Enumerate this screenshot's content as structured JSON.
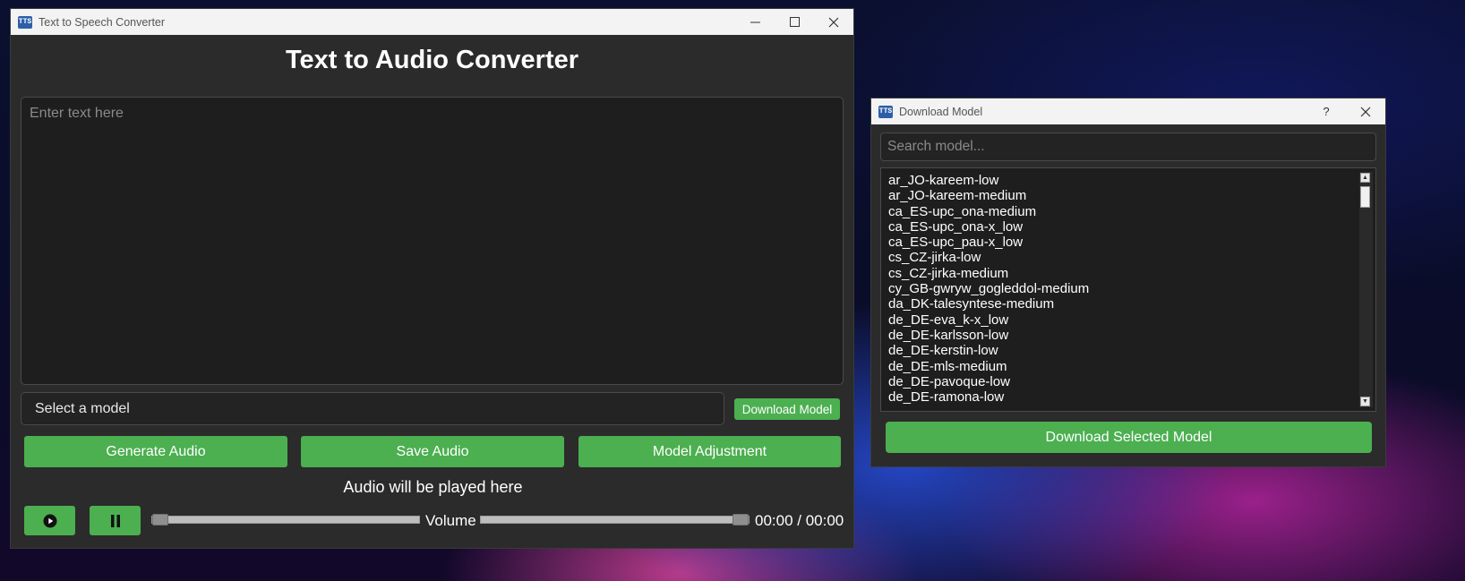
{
  "main_window": {
    "title": "Text to Speech Converter",
    "heading": "Text to Audio Converter",
    "text_placeholder": "Enter text here",
    "model_select": "Select a model",
    "download_model_label": "Download Model",
    "buttons": {
      "generate": "Generate Audio",
      "save": "Save Audio",
      "adjust": "Model Adjustment"
    },
    "status": "Audio will be played here",
    "volume_label": "Volume",
    "time": "00:00 / 00:00",
    "progress_fraction": 0.0,
    "volume_fraction": 1.0,
    "icons": {
      "app": "app-icon",
      "minimize": "minimize-icon",
      "maximize": "maximize-icon",
      "close": "close-icon",
      "play": "play-icon",
      "pause": "pause-icon"
    }
  },
  "dialog": {
    "title": "Download Model",
    "help": "?",
    "search_placeholder": "Search model...",
    "models": [
      "ar_JO-kareem-low",
      "ar_JO-kareem-medium",
      "ca_ES-upc_ona-medium",
      "ca_ES-upc_ona-x_low",
      "ca_ES-upc_pau-x_low",
      "cs_CZ-jirka-low",
      "cs_CZ-jirka-medium",
      "cy_GB-gwryw_gogleddol-medium",
      "da_DK-talesyntese-medium",
      "de_DE-eva_k-x_low",
      "de_DE-karlsson-low",
      "de_DE-kerstin-low",
      "de_DE-mls-medium",
      "de_DE-pavoque-low",
      "de_DE-ramona-low"
    ],
    "download_selected_label": "Download Selected Model"
  },
  "colors": {
    "accent": "#4caf50",
    "window_bg": "#2b2b2b",
    "field_bg": "#1e1e1e"
  }
}
